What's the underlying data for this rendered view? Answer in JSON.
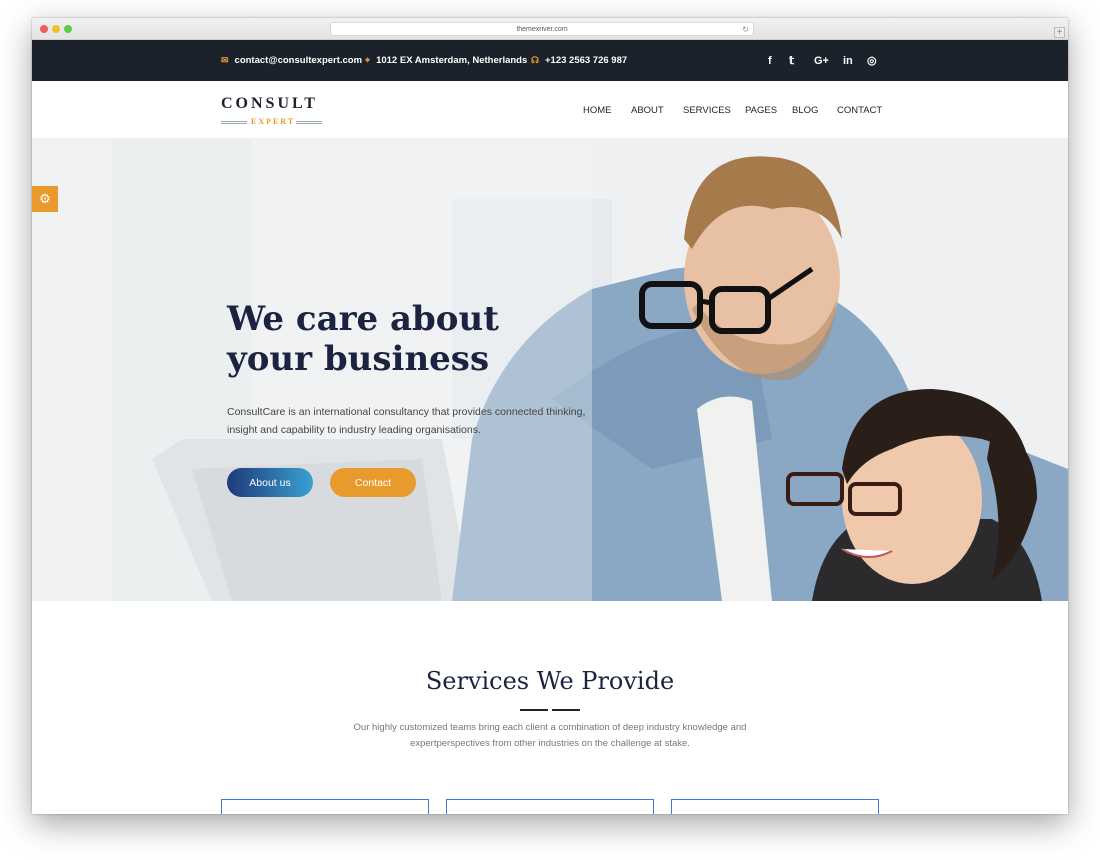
{
  "browser": {
    "url": "themexriver.com",
    "dots": [
      "#ed5f57",
      "#f5be2f",
      "#5fcb44"
    ]
  },
  "topbar": {
    "email": "contact@consultexpert.com",
    "address": "1012 EX Amsterdam, Netherlands",
    "phone": "+123 2563 726 987",
    "social": [
      "f",
      "𝕥",
      "G+",
      "in",
      "◎"
    ]
  },
  "header": {
    "logo_title": "CONSULT",
    "logo_subtitle": "EXPERT",
    "nav": [
      "HOME",
      "ABOUT",
      "SERVICES",
      "PAGES",
      "BLOG",
      "CONTACT"
    ]
  },
  "hero": {
    "title": "We care about your business",
    "text": "ConsultCare is an international consultancy that provides connected thinking, insight and capability to industry leading organisations.",
    "button_primary": "About us",
    "button_secondary": "Contact"
  },
  "services": {
    "title": "Services We Provide",
    "text": "Our highly customized teams bring each client a combination of deep industry knowledge and expertperspectives from other industries on the challenge at stake."
  },
  "colors": {
    "accent": "#e89a2d",
    "dark": "#1b222b",
    "navy": "#1b2340",
    "blue": "#3a7bd5"
  }
}
